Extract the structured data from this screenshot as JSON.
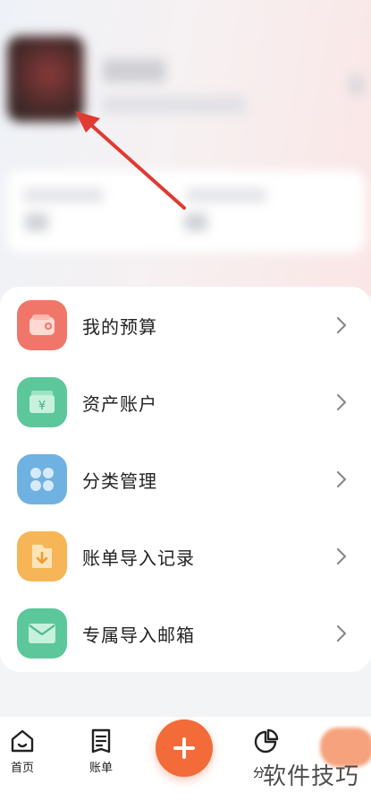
{
  "menu": {
    "items": [
      {
        "label": "我的预算",
        "icon": "wallet-icon",
        "color": "#f0766a"
      },
      {
        "label": "资产账户",
        "icon": "money-card-icon",
        "color": "#5cc79a"
      },
      {
        "label": "分类管理",
        "icon": "grid-icon",
        "color": "#6fb1e0"
      },
      {
        "label": "账单导入记录",
        "icon": "folder-import-icon",
        "color": "#f6b657"
      },
      {
        "label": "专属导入邮箱",
        "icon": "mail-icon",
        "color": "#5cc79a"
      }
    ]
  },
  "tabbar": {
    "home_label": "首页",
    "bills_label": "账单",
    "add_icon": "plus-icon",
    "stats_label_partial": "分",
    "accent": "#f26b38"
  },
  "watermark": "软件技巧",
  "annotation": {
    "arrow_color": "#e03a33"
  }
}
